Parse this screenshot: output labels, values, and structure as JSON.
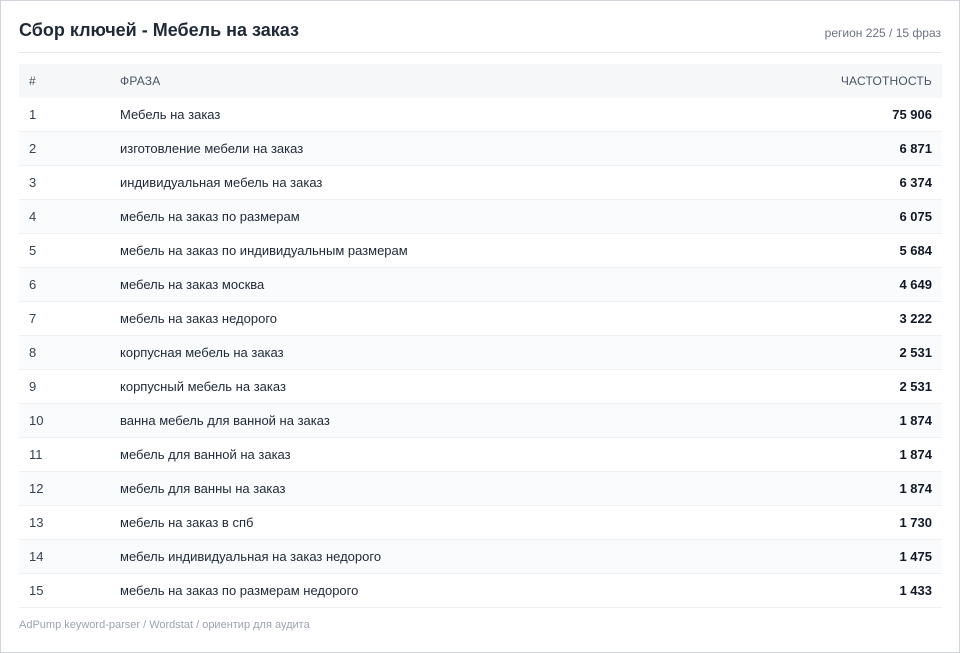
{
  "header": {
    "title": "Сбор ключей - Мебель на заказ",
    "meta": "регион 225 / 15 фраз"
  },
  "table": {
    "columns": [
      "#",
      "ФРАЗА",
      "ЧАСТОТНОСТЬ"
    ],
    "rows": [
      {
        "n": "1",
        "phrase": "Мебель на заказ",
        "freq": "75 906"
      },
      {
        "n": "2",
        "phrase": "изготовление мебели на заказ",
        "freq": "6 871"
      },
      {
        "n": "3",
        "phrase": "индивидуальная мебель на заказ",
        "freq": "6 374"
      },
      {
        "n": "4",
        "phrase": "мебель на заказ по размерам",
        "freq": "6 075"
      },
      {
        "n": "5",
        "phrase": "мебель на заказ по индивидуальным размерам",
        "freq": "5 684"
      },
      {
        "n": "6",
        "phrase": "мебель на заказ москва",
        "freq": "4 649"
      },
      {
        "n": "7",
        "phrase": "мебель на заказ недорого",
        "freq": "3 222"
      },
      {
        "n": "8",
        "phrase": "корпусная мебель на заказ",
        "freq": "2 531"
      },
      {
        "n": "9",
        "phrase": "корпусный мебель на заказ",
        "freq": "2 531"
      },
      {
        "n": "10",
        "phrase": "ванна мебель для ванной на заказ",
        "freq": "1 874"
      },
      {
        "n": "11",
        "phrase": "мебель для ванной на заказ",
        "freq": "1 874"
      },
      {
        "n": "12",
        "phrase": "мебель для ванны на заказ",
        "freq": "1 874"
      },
      {
        "n": "13",
        "phrase": "мебель на заказ в спб",
        "freq": "1 730"
      },
      {
        "n": "14",
        "phrase": "мебель индивидуальная на заказ недорого",
        "freq": "1 475"
      },
      {
        "n": "15",
        "phrase": "мебель на заказ по размерам недорого",
        "freq": "1 433"
      }
    ]
  },
  "footer": {
    "text": "AdPump keyword-parser / Wordstat / ориентир для аудита"
  }
}
